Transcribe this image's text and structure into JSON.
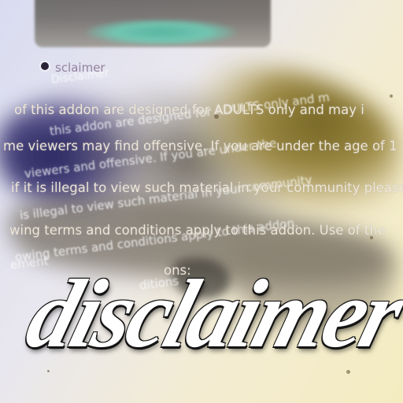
{
  "heading": "sclaimer",
  "lines": [
    "of this addon are designed for ADULTS only and may i",
    "me viewers may find offensive. If you are under the age of 1",
    "if it is illegal to view such material in your community please",
    "wing terms and conditions apply to this addon. Use of the",
    "ons:"
  ],
  "ghost_lines": [
    "Disclaimer",
    "this addon  are designed for ADULTS only and m",
    "viewers and offensive. If you are under the",
    "is illegal to view such material in your community",
    "owing terms and conditions apply to this addon.",
    "ement",
    "ditions"
  ],
  "title": "disclaimer",
  "colors": {
    "paint_navy": "#26235e",
    "paint_olive": "#7a6a22",
    "text": "#f6efe0",
    "title_fill": "#ffffff",
    "title_outline": "#141414"
  }
}
